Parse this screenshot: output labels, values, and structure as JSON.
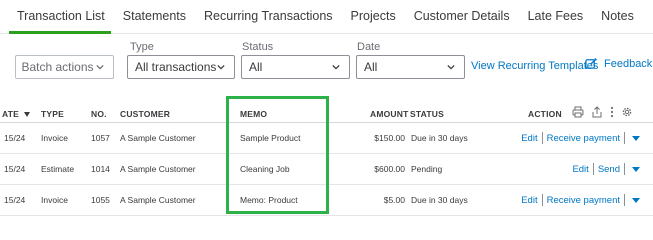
{
  "tabs": [
    {
      "label": "Transaction List",
      "active": true
    },
    {
      "label": "Statements"
    },
    {
      "label": "Recurring Transactions"
    },
    {
      "label": "Projects"
    },
    {
      "label": "Customer Details"
    },
    {
      "label": "Late Fees"
    },
    {
      "label": "Notes"
    }
  ],
  "filters": {
    "batch_actions": "Batch actions",
    "type_label": "Type",
    "type_value": "All transactions",
    "status_label": "Status",
    "status_value": "All",
    "date_label": "Date",
    "date_value": "All",
    "recurring_templates_link": "View Recurring Templates",
    "feedback": "Feedback"
  },
  "table": {
    "headers": {
      "date": "ATE",
      "type": "TYPE",
      "no": "NO.",
      "customer": "CUSTOMER",
      "memo": "MEMO",
      "amount": "AMOUNT",
      "status": "STATUS",
      "action": "ACTION"
    },
    "rows": [
      {
        "date": "15/24",
        "type": "Invoice",
        "no": "1057",
        "customer": "A Sample Customer",
        "memo": "Sample Product",
        "amount": "$150.00",
        "status": "Due in 30 days",
        "action_primary": "Edit",
        "action_secondary": "Receive payment"
      },
      {
        "date": "15/24",
        "type": "Estimate",
        "no": "1014",
        "customer": "A Sample Customer",
        "memo": "Cleaning Job",
        "amount": "$600.00",
        "status": "Pending",
        "action_primary": "Edit",
        "action_secondary": "Send"
      },
      {
        "date": "15/24",
        "type": "Invoice",
        "no": "1055",
        "customer": "A Sample Customer",
        "memo": "Memo: Product",
        "amount": "$5.00",
        "status": "Due in 30 days",
        "action_primary": "Edit",
        "action_secondary": "Receive payment"
      }
    ]
  },
  "colors": {
    "accent_green": "#2ca01c",
    "highlight_green": "#2db24a",
    "link_blue": "#0077c5"
  },
  "icons": [
    "chevron-down-icon",
    "feedback-icon",
    "sort-arrow-icon",
    "print-icon",
    "export-icon",
    "more-icon",
    "settings-icon",
    "caret-down-icon"
  ]
}
